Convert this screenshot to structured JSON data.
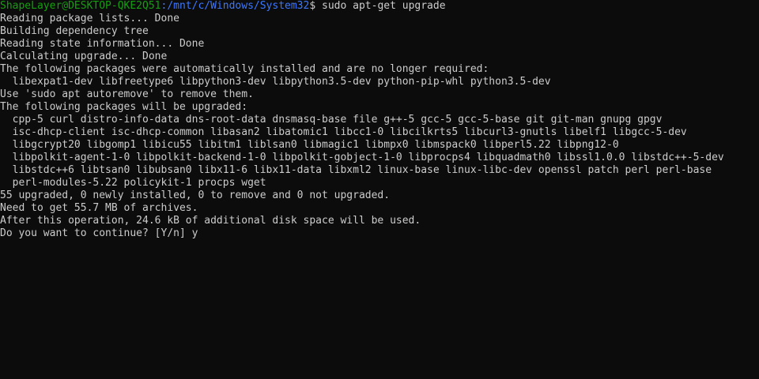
{
  "prompt": {
    "user_host": "ShapeLayer@DESKTOP-QKE2Q51",
    "path": ":/mnt/c/Windows/System32",
    "symbol": "$",
    "command": " sudo apt-get upgrade"
  },
  "output": [
    "Reading package lists... Done",
    "Building dependency tree",
    "Reading state information... Done",
    "Calculating upgrade... Done",
    "The following packages were automatically installed and are no longer required:",
    "  libexpat1-dev libfreetype6 libpython3-dev libpython3.5-dev python-pip-whl python3.5-dev",
    "Use 'sudo apt autoremove' to remove them.",
    "The following packages will be upgraded:",
    "  cpp-5 curl distro-info-data dns-root-data dnsmasq-base file g++-5 gcc-5 gcc-5-base git git-man gnupg gpgv",
    "  isc-dhcp-client isc-dhcp-common libasan2 libatomic1 libcc1-0 libcilkrts5 libcurl3-gnutls libelf1 libgcc-5-dev",
    "  libgcrypt20 libgomp1 libicu55 libitm1 liblsan0 libmagic1 libmpx0 libmspack0 libperl5.22 libpng12-0",
    "  libpolkit-agent-1-0 libpolkit-backend-1-0 libpolkit-gobject-1-0 libprocps4 libquadmath0 libssl1.0.0 libstdc++-5-dev",
    "  libstdc++6 libtsan0 libubsan0 libx11-6 libx11-data libxml2 linux-base linux-libc-dev openssl patch perl perl-base",
    "  perl-modules-5.22 policykit-1 procps wget",
    "55 upgraded, 0 newly installed, 0 to remove and 0 not upgraded.",
    "Need to get 55.7 MB of archives.",
    "After this operation, 24.6 kB of additional disk space will be used.",
    "Do you want to continue? [Y/n] y"
  ],
  "colors": {
    "background": "#0c0c0c",
    "text": "#cccccc",
    "user_host": "#13a10e",
    "path": "#3b78ff"
  }
}
